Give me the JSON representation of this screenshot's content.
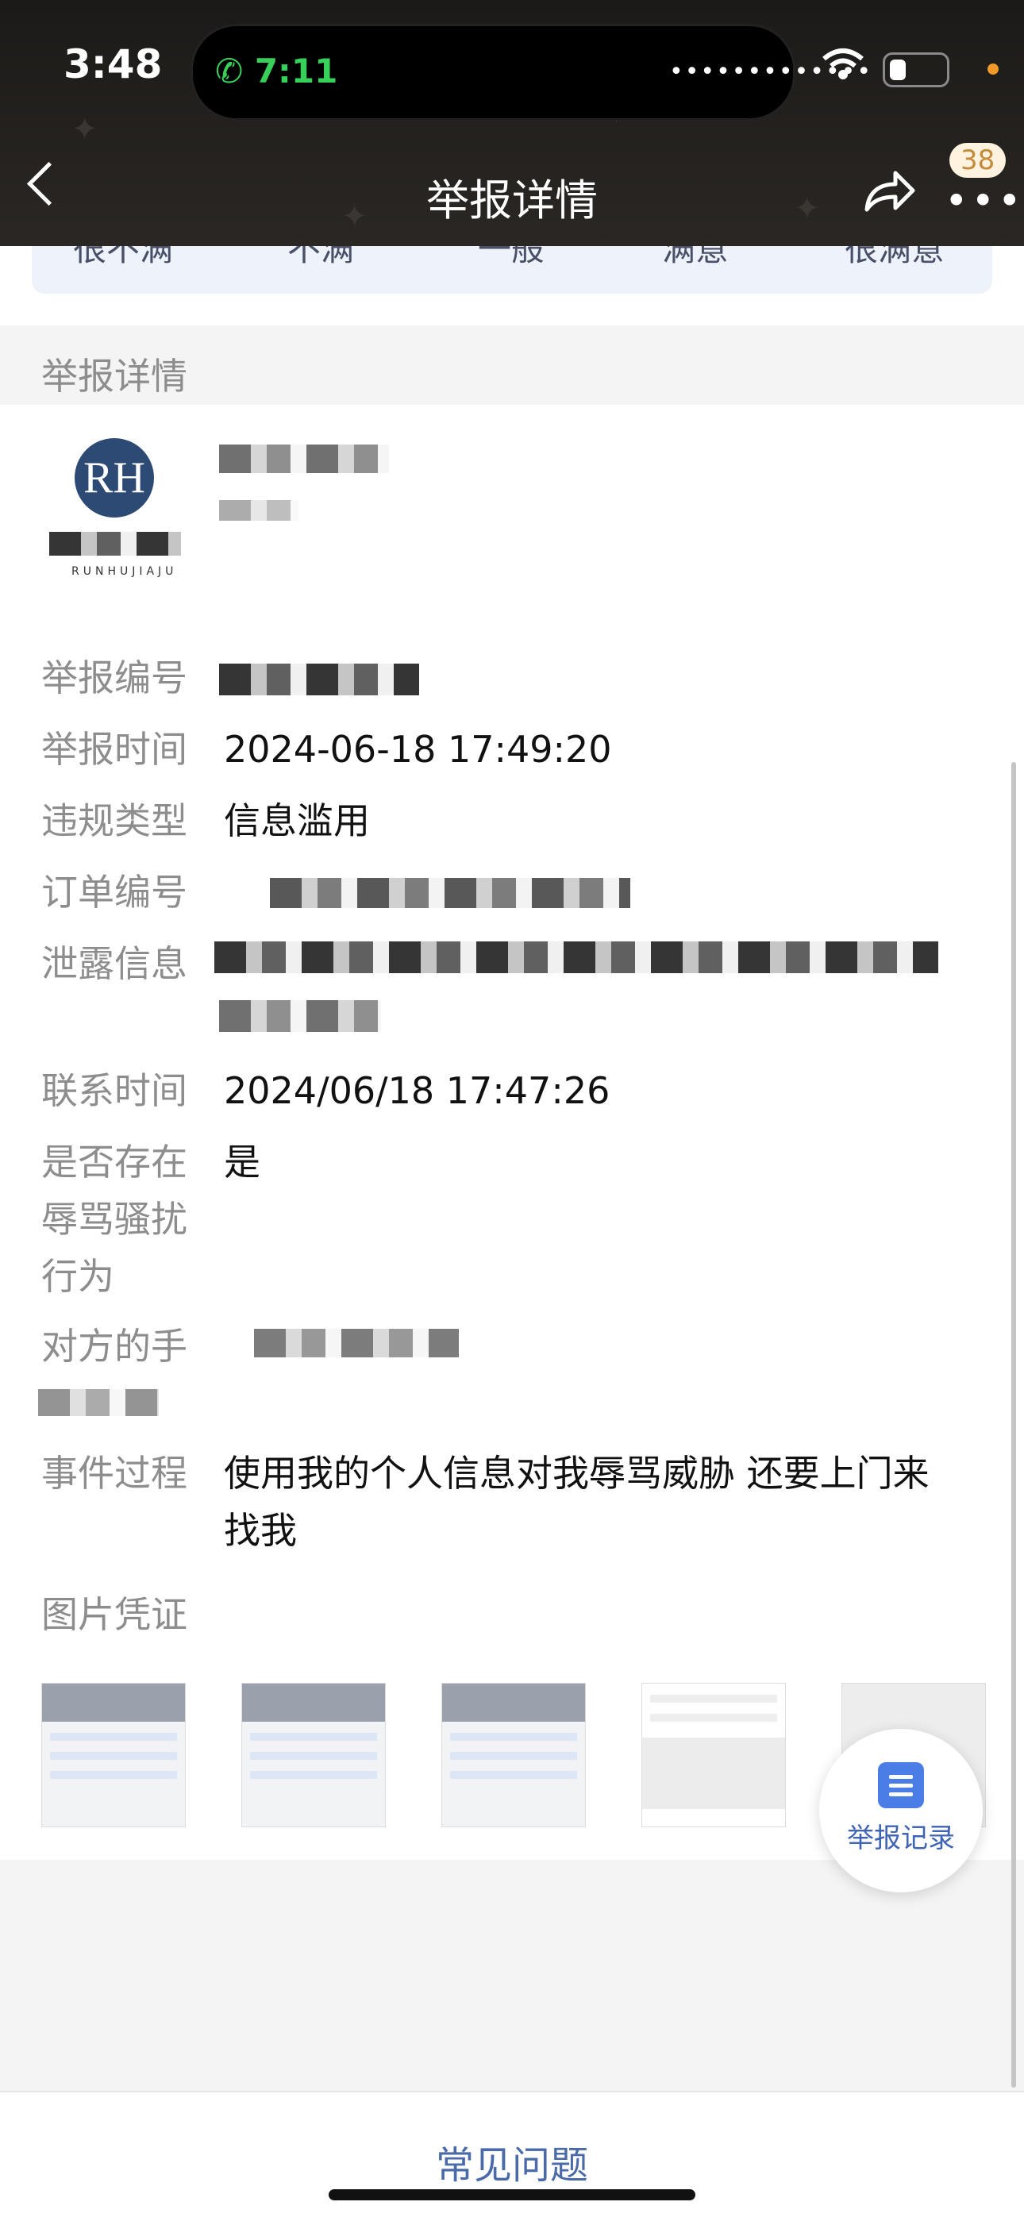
{
  "status_bar": {
    "time": "3:48",
    "call_time": "7:11",
    "call_icon": "phone-icon",
    "wifi_icon": "wifi-icon",
    "battery_icon": "battery-icon"
  },
  "header": {
    "title": "举报详情",
    "badge_count": "38",
    "back_icon": "chevron-left-icon",
    "share_icon": "share-icon",
    "more_icon": "more-dots-icon"
  },
  "rating": {
    "options": [
      "很不满",
      "不满",
      "一般",
      "满意",
      "很满意"
    ]
  },
  "section_title": "举报详情",
  "store": {
    "logo_letters": "RH",
    "logo_caption": "RUNHUJIAJU"
  },
  "details": [
    {
      "label": "举报编号",
      "value": ""
    },
    {
      "label": "举报时间",
      "value": "2024-06-18 17:49:20"
    },
    {
      "label": "违规类型",
      "value": "信息滥用"
    },
    {
      "label": "订单编号",
      "value": ""
    },
    {
      "label": "泄露信息",
      "value": ""
    },
    {
      "label": "联系时间",
      "value": "2024/06/18 17:47:26"
    },
    {
      "label": "是否存在辱骂骚扰行为",
      "value": "是"
    },
    {
      "label": "对方的手",
      "value": ""
    },
    {
      "label": "事件过程",
      "value": "使用我的个人信息对我辱骂威胁 还要上门来找我"
    }
  ],
  "evidence_title": "图片凭证",
  "fab": {
    "label": "举报记录",
    "icon": "document-icon"
  },
  "bottom": {
    "faq": "常见问题"
  },
  "colors": {
    "accent": "#4a7de6",
    "link": "#4a6aa8",
    "header_bg": "#1c1a18"
  }
}
